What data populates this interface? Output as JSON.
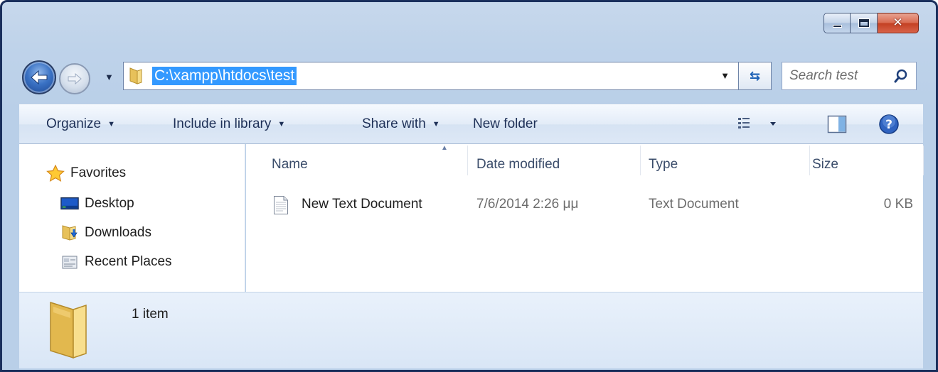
{
  "window": {
    "caption": {
      "min_icon": "minimize-icon",
      "max_icon": "maximize-icon",
      "close_label": "✕"
    }
  },
  "address": {
    "path": "C:\\xampp\\htdocs\\test",
    "dropdown_glyph": "▼",
    "refresh_glyph": "⇆"
  },
  "search": {
    "placeholder": "Search test"
  },
  "nav": {
    "drop_glyph": "▼"
  },
  "toolbar": {
    "organize": "Organize",
    "include_in_library": "Include in library",
    "share_with": "Share with",
    "new_folder": "New folder",
    "arrow": "▼"
  },
  "sidebar": {
    "favorites": "Favorites",
    "items": [
      {
        "label": "Desktop",
        "icon": "desktop-icon"
      },
      {
        "label": "Downloads",
        "icon": "downloads-icon"
      },
      {
        "label": "Recent Places",
        "icon": "recent-places-icon"
      }
    ]
  },
  "columns": {
    "name": "Name",
    "date_modified": "Date modified",
    "type": "Type",
    "size": "Size",
    "sort_glyph": "▲"
  },
  "files": [
    {
      "name": "New Text Document",
      "date_modified": "7/6/2014 2:26 μμ",
      "type": "Text Document",
      "size": "0 KB",
      "icon": "text-document-icon"
    }
  ],
  "details": {
    "count": "1 item"
  },
  "colors": {
    "accent": "#3399ff",
    "frame": "#1a2f5c",
    "chrome": "#bfd3ea"
  }
}
